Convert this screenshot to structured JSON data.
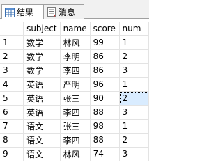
{
  "tabs": [
    {
      "label": "结果",
      "icon": "results-grid-icon",
      "active": true
    },
    {
      "label": "消息",
      "icon": "messages-icon",
      "active": false
    }
  ],
  "grid": {
    "columns": [
      "subject",
      "name",
      "score",
      "num"
    ],
    "rows": [
      {
        "row_number": "1",
        "cells": [
          "数学",
          "林风",
          "99",
          "1"
        ]
      },
      {
        "row_number": "2",
        "cells": [
          "数学",
          "李明",
          "86",
          "2"
        ]
      },
      {
        "row_number": "3",
        "cells": [
          "数学",
          "李四",
          "86",
          "3"
        ]
      },
      {
        "row_number": "4",
        "cells": [
          "英语",
          "严明",
          "96",
          "1"
        ]
      },
      {
        "row_number": "5",
        "cells": [
          "英语",
          "张三",
          "90",
          "2"
        ]
      },
      {
        "row_number": "6",
        "cells": [
          "英语",
          "李四",
          "88",
          "3"
        ]
      },
      {
        "row_number": "7",
        "cells": [
          "语文",
          "张三",
          "98",
          "1"
        ]
      },
      {
        "row_number": "8",
        "cells": [
          "语文",
          "李四",
          "88",
          "2"
        ]
      },
      {
        "row_number": "9",
        "cells": [
          "语文",
          "林风",
          "74",
          "3"
        ]
      }
    ],
    "selected_cell": {
      "row": 4,
      "col": 3
    }
  },
  "colors": {
    "selected_cell_bg": "#d9ecff",
    "grid_line": "#e3e3e3",
    "tab_border": "#a0a0a0"
  }
}
